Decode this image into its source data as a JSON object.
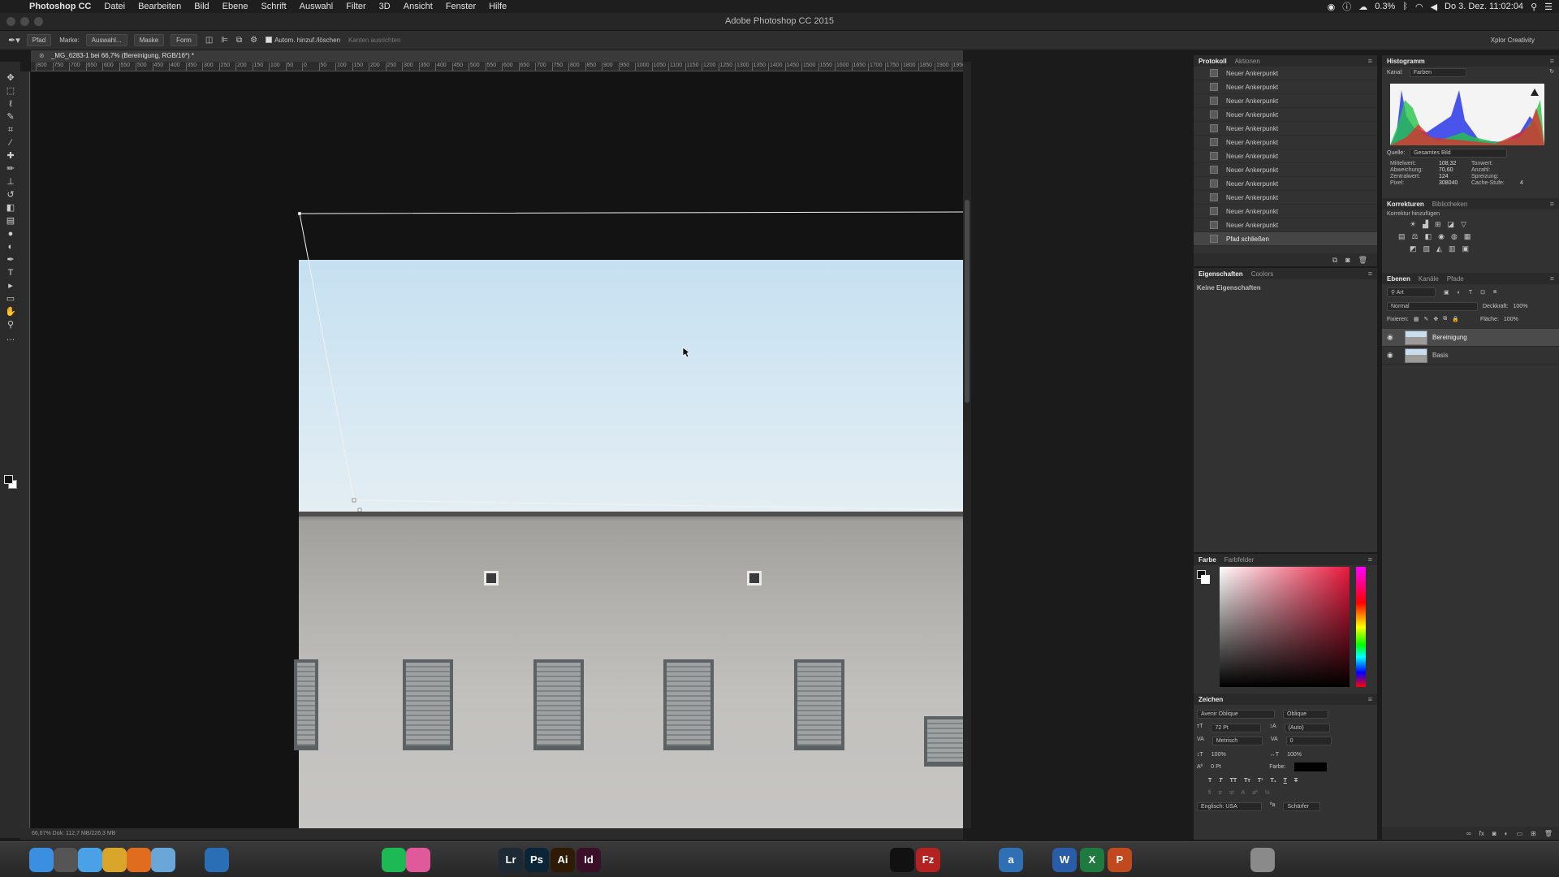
{
  "menubar": {
    "app_name": "Photoshop CC",
    "items": [
      "Datei",
      "Bearbeiten",
      "Bild",
      "Ebene",
      "Schrift",
      "Auswahl",
      "Filter",
      "3D",
      "Ansicht",
      "Fenster",
      "Hilfe"
    ],
    "battery": "0.3%",
    "clock": "Do 3. Dez. 11:02:04"
  },
  "window": {
    "title": "Adobe Photoshop CC 2015"
  },
  "options_bar": {
    "tool_mode": "Pfad",
    "make_label": "Marke:",
    "selection_button": "Auswahl...",
    "mask_button": "Maske",
    "shape_button": "Form",
    "auto_add_delete": "Autom. hinzuf./löschen",
    "align_edges": "Kanten ausrichten",
    "workspace": "Xplor Creativity"
  },
  "document": {
    "tab_title": "_MG_6283-1 bei 66,7% (Bereinigung, RGB/16*) *",
    "status": "66,67%   Dok: 112,7 MB/226,3 MB"
  },
  "ruler": {
    "labels": [
      "800",
      "750",
      "700",
      "650",
      "600",
      "550",
      "500",
      "450",
      "400",
      "350",
      "300",
      "250",
      "200",
      "150",
      "100",
      "50",
      "0",
      "50",
      "100",
      "150",
      "200",
      "250",
      "300",
      "350",
      "400",
      "450",
      "500",
      "550",
      "600",
      "650",
      "700",
      "750",
      "800",
      "850",
      "900",
      "950",
      "1000",
      "1050",
      "1100",
      "1150",
      "1200",
      "1250",
      "1300",
      "1350",
      "1400",
      "1450",
      "1500",
      "1550",
      "1600",
      "1650",
      "1700",
      "1750",
      "1800",
      "1850",
      "1900",
      "1950"
    ]
  },
  "tools": [
    {
      "name": "move-tool-icon",
      "glyph": "✥"
    },
    {
      "name": "marquee-tool-icon",
      "glyph": "⬚"
    },
    {
      "name": "lasso-tool-icon",
      "glyph": "ℓ"
    },
    {
      "name": "quick-select-tool-icon",
      "glyph": "✎"
    },
    {
      "name": "crop-tool-icon",
      "glyph": "⌗"
    },
    {
      "name": "eyedropper-tool-icon",
      "glyph": "⁄"
    },
    {
      "name": "healing-tool-icon",
      "glyph": "✚"
    },
    {
      "name": "brush-tool-icon",
      "glyph": "✏"
    },
    {
      "name": "stamp-tool-icon",
      "glyph": "⊥"
    },
    {
      "name": "history-brush-icon",
      "glyph": "↺"
    },
    {
      "name": "eraser-tool-icon",
      "glyph": "◧"
    },
    {
      "name": "gradient-tool-icon",
      "glyph": "▤"
    },
    {
      "name": "blur-tool-icon",
      "glyph": "●"
    },
    {
      "name": "dodge-tool-icon",
      "glyph": "◐"
    },
    {
      "name": "pen-tool-icon",
      "glyph": "✒"
    },
    {
      "name": "type-tool-icon",
      "glyph": "T"
    },
    {
      "name": "path-select-tool-icon",
      "glyph": "▸"
    },
    {
      "name": "shape-tool-icon",
      "glyph": "▭"
    },
    {
      "name": "hand-tool-icon",
      "glyph": "✋"
    },
    {
      "name": "zoom-tool-icon",
      "glyph": "⚲"
    },
    {
      "name": "more-tools-icon",
      "glyph": "…"
    }
  ],
  "history_panel": {
    "tabs": [
      "Protokoll",
      "Aktionen"
    ],
    "items": [
      "Neuer Ankerpunkt",
      "Neuer Ankerpunkt",
      "Neuer Ankerpunkt",
      "Neuer Ankerpunkt",
      "Neuer Ankerpunkt",
      "Neuer Ankerpunkt",
      "Neuer Ankerpunkt",
      "Neuer Ankerpunkt",
      "Neuer Ankerpunkt",
      "Neuer Ankerpunkt",
      "Neuer Ankerpunkt",
      "Neuer Ankerpunkt",
      "Pfad schließen"
    ],
    "selected_index": 12
  },
  "properties_panel": {
    "tabs": [
      "Eigenschaften",
      "Coolors"
    ],
    "empty_text": "Keine Eigenschaften"
  },
  "color_panel": {
    "tabs": [
      "Farbe",
      "Farbfelder"
    ],
    "hue_color": "#e8183c"
  },
  "character_panel": {
    "title": "Zeichen",
    "font_family": "Avenir Oblique",
    "font_style": "Oblique",
    "font_size": "72 Pt",
    "leading": "(Auto)",
    "kerning": "Metrisch",
    "tracking": "0",
    "vertical_scale": "100%",
    "horizontal_scale": "100%",
    "baseline": "0 Pt",
    "color_label": "Farbe:",
    "language": "Englisch: USA",
    "antialias": "Schärfer"
  },
  "histogram_panel": {
    "title": "Histogramm",
    "channel_label": "Kanal:",
    "channel": "Farben",
    "source_label": "Quelle:",
    "source": "Gesamtes Bild",
    "stats": [
      {
        "label": "Mittelwert:",
        "value": "108,32",
        "label2": "Tonwert:",
        "value2": ""
      },
      {
        "label": "Abweichung:",
        "value": "70,60",
        "label2": "Anzahl:",
        "value2": ""
      },
      {
        "label": "Zentralwert:",
        "value": "124",
        "label2": "Spreizung:",
        "value2": ""
      },
      {
        "label": "Pixel:",
        "value": "308040",
        "label2": "Cache-Stufe:",
        "value2": "4"
      }
    ]
  },
  "adjustments_panel": {
    "tabs": [
      "Korrekturen",
      "Bibliotheken"
    ],
    "add_label": "Korrektur hinzufügen"
  },
  "layers_panel": {
    "tabs": [
      "Ebenen",
      "Kanäle",
      "Pfade"
    ],
    "filter_kind": "Art",
    "blend_mode": "Normal",
    "opacity_label": "Deckkraft:",
    "opacity": "100%",
    "lock_label": "Fixieren:",
    "fill_label": "Fläche:",
    "fill": "100%",
    "layers": [
      {
        "name": "Bereinigung",
        "selected": true
      },
      {
        "name": "Basis",
        "selected": false
      }
    ]
  },
  "dock": [
    {
      "name": "finder-icon",
      "label": "",
      "color": "#3b8fe0"
    },
    {
      "name": "launchpad-icon",
      "label": "",
      "color": "#555"
    },
    {
      "name": "safari-icon",
      "label": "",
      "color": "#4aa1e5"
    },
    {
      "name": "chrome-icon",
      "label": "",
      "color": "#d9a52a"
    },
    {
      "name": "firefox-icon",
      "label": "",
      "color": "#e06d1e"
    },
    {
      "name": "mail-icon",
      "label": "",
      "color": "#6aa6d8"
    },
    {
      "name": "1password-icon",
      "label": "",
      "color": "#2a6fb6"
    },
    {
      "name": "lightroom-icon",
      "label": "Lr",
      "color": "#1d2a36"
    },
    {
      "name": "photoshop-icon",
      "label": "Ps",
      "color": "#0c2437"
    },
    {
      "name": "illustrator-icon",
      "label": "Ai",
      "color": "#2f1b05"
    },
    {
      "name": "indesign-icon",
      "label": "Id",
      "color": "#3a0f27"
    },
    {
      "name": "spotify-icon",
      "label": "",
      "color": "#1db954"
    },
    {
      "name": "itunes-icon",
      "label": "",
      "color": "#e05a9b"
    },
    {
      "name": "terminal-icon",
      "label": "",
      "color": "#111"
    },
    {
      "name": "filezilla-icon",
      "label": "Fz",
      "color": "#b32121"
    },
    {
      "name": "amazon-icon",
      "label": "a",
      "color": "#2f6fb3"
    },
    {
      "name": "word-icon",
      "label": "W",
      "color": "#2a5da8"
    },
    {
      "name": "excel-icon",
      "label": "X",
      "color": "#1f7a3f"
    },
    {
      "name": "powerpoint-icon",
      "label": "P",
      "color": "#c04a1d"
    },
    {
      "name": "trash-icon",
      "label": "",
      "color": "#8a8a8a"
    }
  ]
}
